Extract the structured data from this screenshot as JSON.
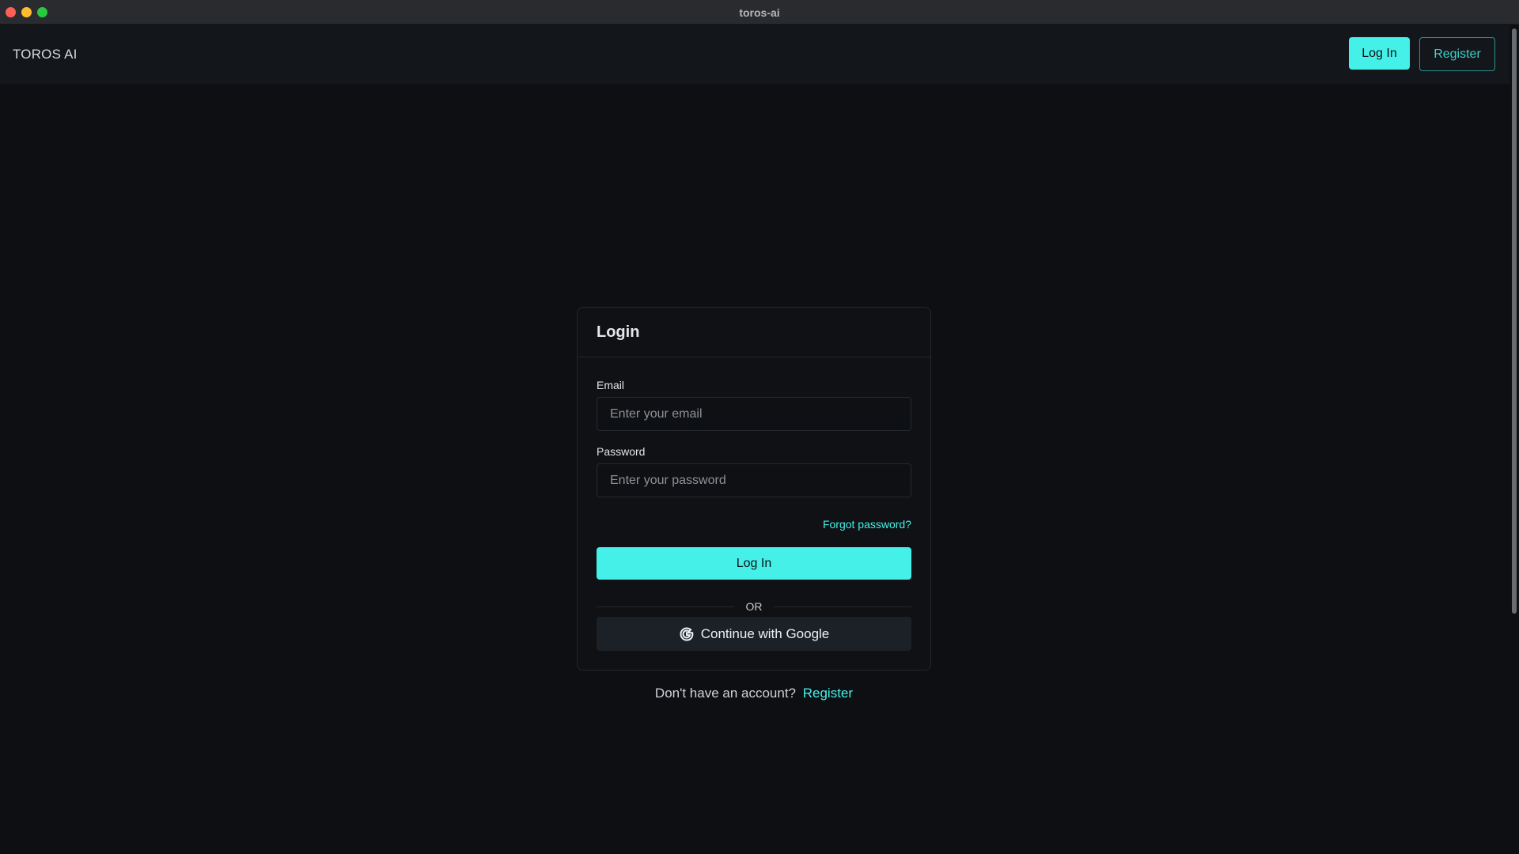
{
  "window": {
    "title": "toros-ai"
  },
  "header": {
    "brand": "TOROS AI",
    "login_label": "Log In",
    "register_label": "Register"
  },
  "login_card": {
    "title": "Login",
    "email_label": "Email",
    "email_placeholder": "Enter your email",
    "email_value": "",
    "password_label": "Password",
    "password_placeholder": "Enter your password",
    "password_value": "",
    "forgot_password": "Forgot password?",
    "submit_label": "Log In",
    "divider_text": "OR",
    "google_label": "Continue with Google"
  },
  "signup": {
    "prompt": "Don't have an account?",
    "link_label": "Register"
  },
  "icons": {
    "google": "google-g-icon"
  },
  "colors": {
    "accent": "#45f0e9",
    "background": "#0e0f12",
    "header_bg": "#13161b",
    "google_button_bg": "#1c2128"
  }
}
